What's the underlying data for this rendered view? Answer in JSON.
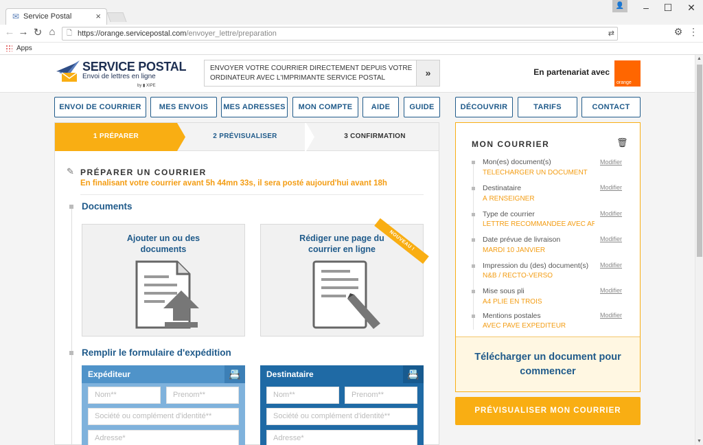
{
  "browser": {
    "tab_title": "Service Postal",
    "url_host": "https://orange.servicepostal.com",
    "url_path": "/envoyer_lettre/preparation",
    "bookmarks_apps": "Apps"
  },
  "header": {
    "logo_name": "SERVICE POSTAL",
    "logo_tagline": "Envoi de lettres en ligne",
    "logo_by": "by ▮ XIPE",
    "banner_text": "ENVOYER VOTRE COURRIER DIRECTEMENT DEPUIS VOTRE ORDINATEUR AVEC L'IMPRIMANTE SERVICE POSTAL",
    "banner_arrow": "»",
    "partner_text": "En partenariat avec",
    "partner_logo_text": "orange"
  },
  "nav": {
    "items": [
      "ENVOI DE COURRIER",
      "MES ENVOIS",
      "MES ADRESSES",
      "MON COMPTE",
      "AIDE",
      "GUIDE"
    ],
    "right_items": [
      "DÉCOUVRIR",
      "TARIFS",
      "CONTACT"
    ]
  },
  "steps": [
    "1 PRÉPARER",
    "2 PRÉVISUALISER",
    "3 CONFIRMATION"
  ],
  "prepare": {
    "title": "PRÉPARER UN COURRIER",
    "deadline_note": "En finalisant votre courrier avant 5h 44mn 33s, il sera posté aujourd'hui avant 18h",
    "documents_title": "Documents",
    "card_upload": "Ajouter un ou des documents",
    "card_write": "Rédiger une page du courrier en ligne",
    "ribbon": "NOUVEAU !",
    "form_title": "Remplir le formulaire d'expédition"
  },
  "forms": {
    "sender": {
      "title": "Expéditeur",
      "nom": "Nom**",
      "prenom": "Prenom**",
      "societe": "Société ou complément d'identité**",
      "adresse": "Adresse*"
    },
    "recipient": {
      "title": "Destinataire",
      "nom": "Nom**",
      "prenom": "Prenom**",
      "societe": "Société ou complément d'identité**",
      "adresse": "Adresse*"
    }
  },
  "sidebar": {
    "title": "MON COURRIER",
    "modify_label": "Modifier",
    "items": [
      {
        "label": "Mon(es) document(s)",
        "value": "TÉLÉCHARGER UN DOCUMENT"
      },
      {
        "label": "Destinataire",
        "value": "À RENSEIGNER"
      },
      {
        "label": "Type de courrier",
        "value": "LETTRE RECOMMANDÉE AVEC AR"
      },
      {
        "label": "Date prévue de livraison",
        "value": "MARDI 10 JANVIER"
      },
      {
        "label": "Impression du (des) document(s)",
        "value": "N&B / RECTO-VERSO"
      },
      {
        "label": "Mise sous pli",
        "value": "A4 PLIÉ EN TROIS"
      },
      {
        "label": "Mentions postales",
        "value": "AVEC PAVÉ EXPÉDITEUR"
      }
    ],
    "cta": "Télécharger un document pour commencer",
    "preview_button": "PRÉVISUALISER MON COURRIER"
  },
  "colors": {
    "accent": "#f9ae13",
    "brand_blue": "#1f5a8a",
    "sender_header": "#4f93c9",
    "recipient_header": "#1f6aa5",
    "orange_logo": "#ff6600"
  }
}
